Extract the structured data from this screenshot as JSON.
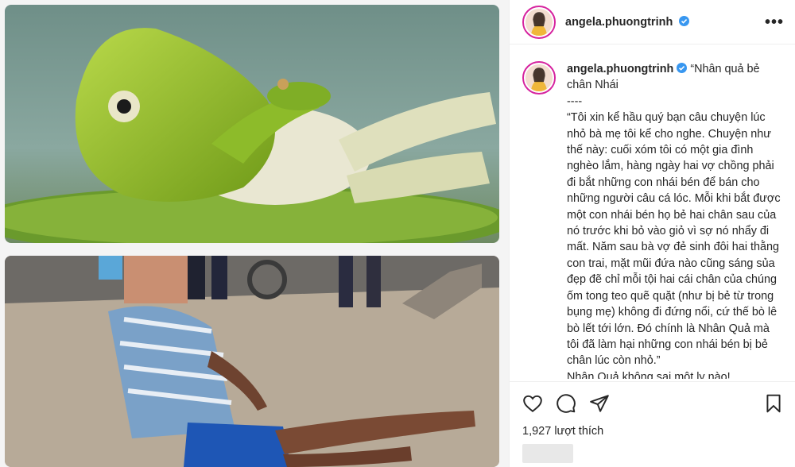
{
  "post": {
    "username": "angela.phuongtrinh",
    "caption_lines": [
      "“Nhân quả bẻ chân Nhái",
      "----",
      "“Tôi xin kể hầu quý bạn câu chuyện lúc nhỏ bà mẹ tôi kể cho nghe. Chuyện như thế này: cuối xóm tôi có một gia đình nghèo lắm, hàng ngày hai vợ chồng phải đi bắt những con nhái bén để bán cho những người câu cá lóc. Mỗi khi bắt được một con nhái bén họ bẻ hai chân sau của nó trước khi bỏ vào giỏ vì sợ nó nhẩy đi mất. Năm sau bà vợ đẻ sinh đôi hai thằng con trai, mặt mũi đứa nào cũng sáng sủa đẹp đẽ chỉ mỗi tội hai cái chân của chúng ốm tong teo quẽ quặt (như bị bẻ từ trong bụng mẹ) không đi đứng nổi, cứ thế bò lê bò lết tới lớn. Đó chính là Nhân Quả mà tôi đã làm hại những con nhái bén bị bẻ chân lúc còn nhỏ.”",
      "Nhân Quả không sai một ly nào!"
    ],
    "likes_text": "1,927 lượt thích"
  },
  "icons": {
    "more": "more-options-icon",
    "like": "heart-icon",
    "comment": "comment-icon",
    "share": "send-icon",
    "save": "bookmark-icon",
    "verified": "verified-badge-icon"
  },
  "colors": {
    "verified_blue": "#3897f0",
    "story_ring": "#d6249f",
    "text": "#262626",
    "divider": "#efefef"
  },
  "more_label": "•••"
}
